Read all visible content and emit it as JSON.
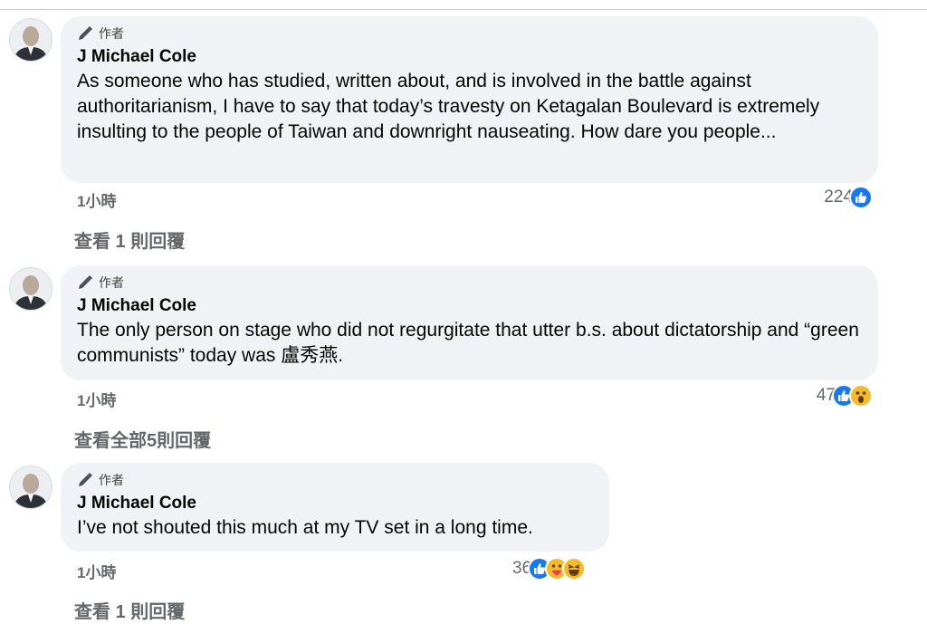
{
  "comments": [
    {
      "badge": "作者",
      "name": "J Michael Cole",
      "text": "As someone who has studied, written about, and is involved in the battle against authoritarianism, I have to say that today’s travesty on Ketagalan Boulevard is extremely insulting to the people of Taiwan and downright nauseating. How dare you people...",
      "time": "1小時",
      "reaction_count": "224",
      "reactions": [
        "like-icon"
      ],
      "replies": "查看 1 則回覆"
    },
    {
      "badge": "作者",
      "name": "J Michael Cole",
      "text": "The only person on stage who did not regurgitate that utter b.s. about dictatorship and “green communists” today was 盧秀燕.",
      "time": "1小時",
      "reaction_count": "47",
      "reactions": [
        "like-icon",
        "wow-icon"
      ],
      "replies": "查看全部5則回覆"
    },
    {
      "badge": "作者",
      "name": "J Michael Cole",
      "text": "I’ve not shouted this much at my TV set in a long time.",
      "time": "1小時",
      "reaction_count": "36",
      "reactions": [
        "like-icon",
        "care-icon",
        "haha-icon"
      ],
      "replies": "查看 1 則回覆"
    }
  ],
  "colors": {
    "bubble": "#f0f2f5",
    "like": "#1877f2",
    "emoji": "#f7b928",
    "meta": "#65676b"
  }
}
